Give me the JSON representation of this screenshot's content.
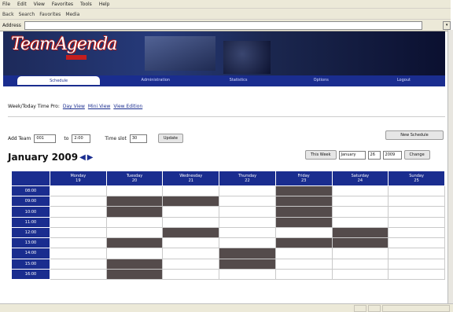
{
  "browser": {
    "menu": [
      "File",
      "Edit",
      "View",
      "Favorites",
      "Tools",
      "Help"
    ],
    "toolbar": [
      "Back",
      "Search",
      "Favorites",
      "Media"
    ],
    "address_label": "Address"
  },
  "banner": {
    "logo_text": "TeamAgenda"
  },
  "nav": {
    "tabs": [
      "Schedule",
      "Administration",
      "Statistics",
      "Options",
      "Logout"
    ],
    "active_index": 0
  },
  "view_by": {
    "label": "Week/Today Time Pro:",
    "links": [
      "Day View",
      "Mini View",
      "View Edition"
    ]
  },
  "edit": {
    "add_label": "Add Team",
    "add_value": "001",
    "to_label": "to",
    "to_value": "2:00",
    "timeslot_label": "Time slot",
    "timeslot_value": "30",
    "update_button": "Update"
  },
  "new_schedule_button": "New Schedule",
  "calendar": {
    "title": "January 2009",
    "this_week_button": "This Week",
    "month_select": "January",
    "day_select": "26",
    "year_select": "2009",
    "change_button": "Change",
    "days": [
      {
        "name": "Monday",
        "date": "19"
      },
      {
        "name": "Tuesday",
        "date": "20"
      },
      {
        "name": "Wednesday",
        "date": "21"
      },
      {
        "name": "Thursday",
        "date": "22"
      },
      {
        "name": "Friday",
        "date": "23"
      },
      {
        "name": "Saturday",
        "date": "24"
      },
      {
        "name": "Sunday",
        "date": "25"
      }
    ],
    "rows": [
      {
        "time": "08:00",
        "busy": [
          false,
          false,
          false,
          false,
          true,
          false,
          false
        ]
      },
      {
        "time": "09:00",
        "busy": [
          false,
          true,
          true,
          false,
          true,
          false,
          false
        ]
      },
      {
        "time": "10:00",
        "busy": [
          false,
          true,
          false,
          false,
          true,
          false,
          false
        ]
      },
      {
        "time": "11:00",
        "busy": [
          false,
          false,
          false,
          false,
          true,
          false,
          false
        ]
      },
      {
        "time": "12:00",
        "busy": [
          false,
          false,
          true,
          false,
          false,
          true,
          false
        ]
      },
      {
        "time": "13:00",
        "busy": [
          false,
          true,
          false,
          false,
          true,
          true,
          false
        ]
      },
      {
        "time": "14:00",
        "busy": [
          false,
          false,
          false,
          true,
          false,
          false,
          false
        ]
      },
      {
        "time": "15:00",
        "busy": [
          false,
          true,
          false,
          true,
          false,
          false,
          false
        ]
      },
      {
        "time": "16:00",
        "busy": [
          false,
          true,
          false,
          false,
          false,
          false,
          false
        ]
      }
    ]
  },
  "colors": {
    "nav_blue": "#1a2d8f",
    "busy": "#544b4b"
  }
}
